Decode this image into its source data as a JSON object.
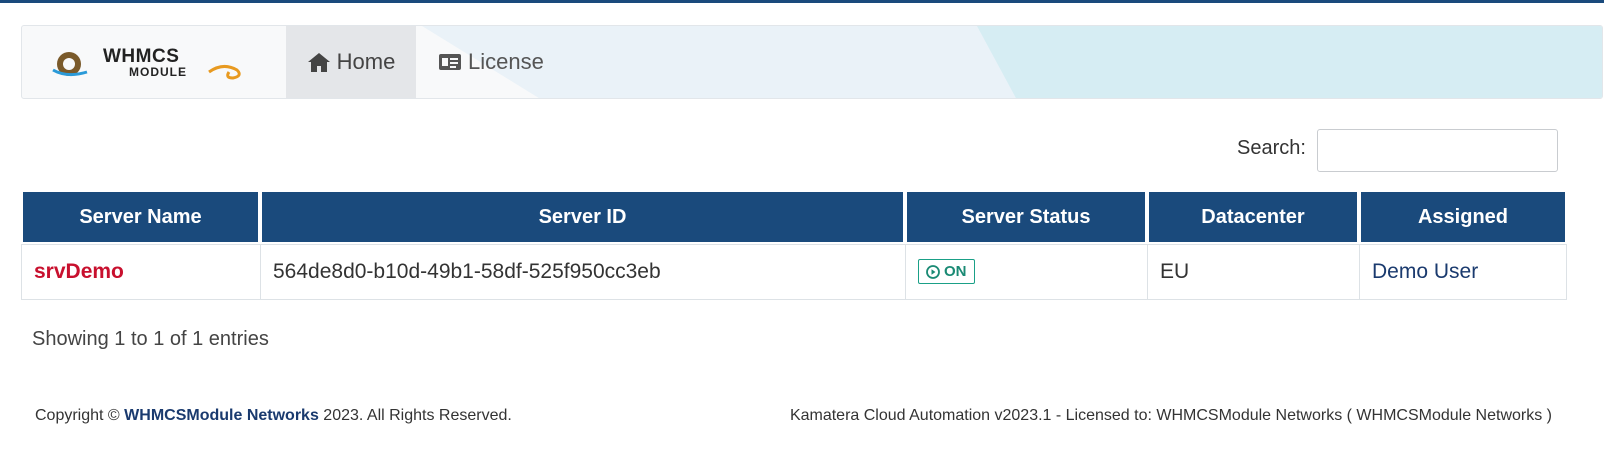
{
  "brand": {
    "logo_line1": "WHMCS",
    "logo_line2": "MODULE"
  },
  "nav": {
    "home_label": "Home",
    "license_label": "License"
  },
  "search": {
    "label": "Search:",
    "value": "",
    "placeholder": ""
  },
  "table": {
    "columns": [
      "Server Name",
      "Server ID",
      "Server Status",
      "Datacenter",
      "Assigned"
    ],
    "rows": [
      {
        "name": "srvDemo",
        "id": "564de8d0-b10d-49b1-58df-525f950cc3eb",
        "status": "ON",
        "datacenter": "EU",
        "assigned": "Demo User"
      }
    ]
  },
  "entries_info": "Showing 1 to 1 of 1 entries",
  "footer": {
    "copyright_prefix": "Copyright ©",
    "company": "WHMCSModule Networks",
    "copyright_suffix": "2023. All Rights Reserved.",
    "license_text": "Kamatera Cloud Automation v2023.1 - Licensed to: WHMCSModule Networks ( WHMCSModule Networks )"
  },
  "colors": {
    "primary": "#1a4a7c",
    "server_name": "#c8102e",
    "status_on": "#1aa087",
    "link": "#1a3a6e"
  },
  "icons": {
    "home": "home-icon",
    "license": "id-card-icon",
    "status": "play-circle-icon"
  }
}
